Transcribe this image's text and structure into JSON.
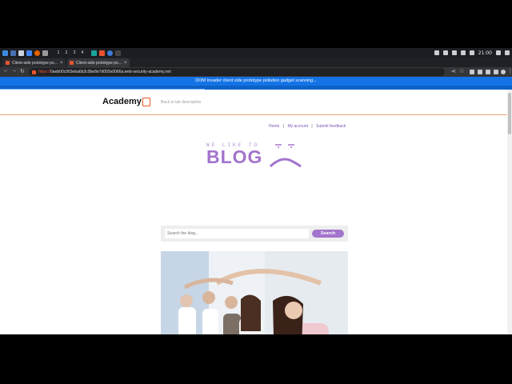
{
  "taskbar": {
    "workspaces": [
      "1",
      "2",
      "3",
      "4"
    ],
    "clock": "21:00"
  },
  "browser": {
    "tabs": [
      {
        "title": "Client-side prototype po..."
      },
      {
        "title": "Client-side prototype po..."
      }
    ],
    "new_tab": "+",
    "url_scheme": "https://",
    "url_rest": "0aeb00c903eba6b3c0be8e7d002e0066a.web-security-academy.net"
  },
  "dom_invader": {
    "message": "DOM Invader client side prototype pollution gadget scanning...",
    "progress": 0.4
  },
  "academy": {
    "logo": "Academy",
    "back_link": "Back to lab description"
  },
  "nav": {
    "home": "Home",
    "sep1": "|",
    "account": "My account",
    "sep2": "|",
    "feedback": "Submit feedback"
  },
  "blog_logo": {
    "tagline": "WE LIKE TO",
    "word": "BLOG"
  },
  "search": {
    "placeholder": "Search the blog...",
    "button": "Search"
  },
  "colors": {
    "accent": "#a274cc",
    "invader_bar": "#1473e6",
    "header_rule": "#f0a57a"
  }
}
